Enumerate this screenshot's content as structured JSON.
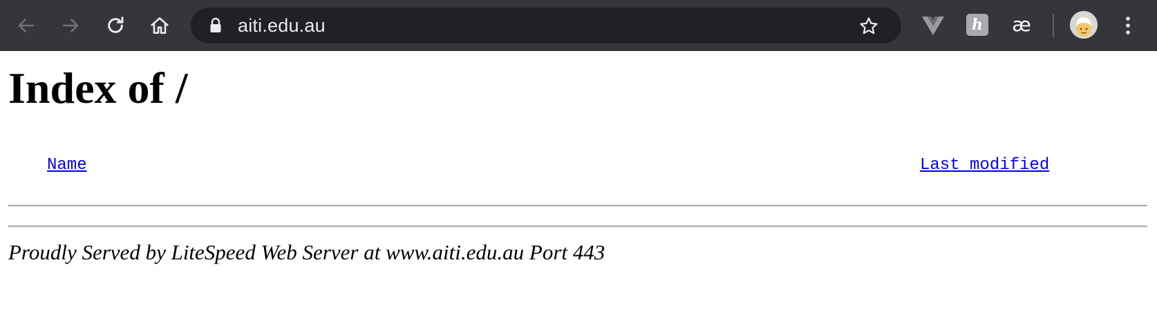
{
  "browser": {
    "url": "aiti.edu.au",
    "extension_h_label": "h",
    "extension_ae_label": "æ",
    "icons": {
      "back": "back-arrow-icon",
      "forward": "forward-arrow-icon",
      "reload": "reload-icon",
      "home": "home-icon",
      "secure": "lock-icon",
      "bookmark": "star-icon",
      "vue_devtools": "vue-devtools-icon",
      "menu": "vertical-dots-menu-icon"
    },
    "colors": {
      "toolbar": "#35363a",
      "omnibox": "#202124",
      "text": "#e8eaed",
      "icon": "#e8eaed",
      "icon_disabled": "#6f7276"
    }
  },
  "page": {
    "title": "Index of /",
    "columns": {
      "name": "Name",
      "last_modified": "Last modified"
    },
    "rows": [],
    "footer": "Proudly Served by LiteSpeed Web Server at www.aiti.edu.au Port 443",
    "colors": {
      "link": "#0000ee",
      "text": "#000000",
      "background": "#ffffff"
    }
  }
}
